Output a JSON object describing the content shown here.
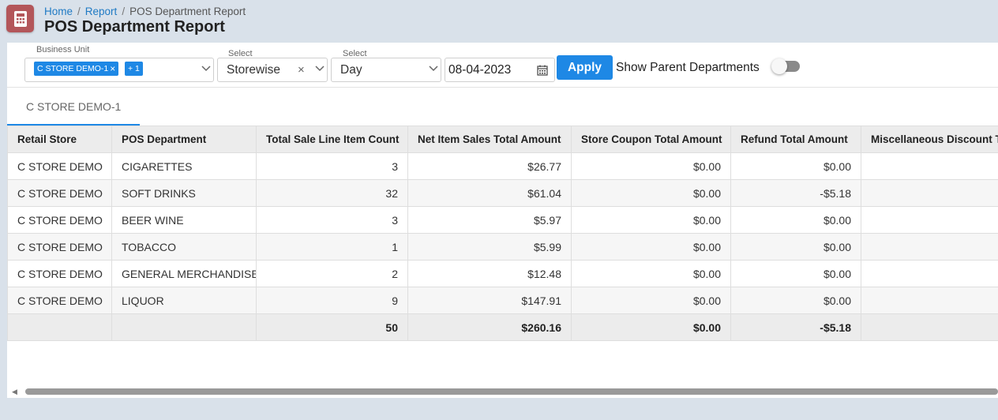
{
  "breadcrumb": {
    "home": "Home",
    "report": "Report",
    "current": "POS Department Report"
  },
  "page": {
    "title": "POS Department Report"
  },
  "filters": {
    "business_unit": {
      "label": "Business Unit",
      "chip": "C STORE DEMO-1",
      "more_chip": "+ 1"
    },
    "grouping": {
      "label": "Select",
      "value": "Storewise"
    },
    "period": {
      "label": "Select",
      "value": "Day"
    },
    "date": {
      "value": "08-04-2023"
    },
    "apply_label": "Apply",
    "show_parent_label": "Show Parent Departments",
    "show_parent_enabled": false
  },
  "tabs": [
    {
      "label": "C STORE DEMO-1",
      "active": true
    }
  ],
  "table": {
    "columns": [
      "Retail Store",
      "POS Department",
      "Total Sale Line Item Count",
      "Net Item Sales Total Amount",
      "Store Coupon Total Amount",
      "Refund Total Amount",
      "Miscellaneous Discount Total Amount"
    ],
    "rows": [
      [
        "C STORE DEMO",
        "CIGARETTES",
        "3",
        "$26.77",
        "$0.00",
        "$0.00",
        ""
      ],
      [
        "C STORE DEMO",
        "SOFT DRINKS",
        "32",
        "$61.04",
        "$0.00",
        "-$5.18",
        ""
      ],
      [
        "C STORE DEMO",
        "BEER WINE",
        "3",
        "$5.97",
        "$0.00",
        "$0.00",
        ""
      ],
      [
        "C STORE DEMO",
        "TOBACCO",
        "1",
        "$5.99",
        "$0.00",
        "$0.00",
        ""
      ],
      [
        "C STORE DEMO",
        "GENERAL MERCHANDISE",
        "2",
        "$12.48",
        "$0.00",
        "$0.00",
        ""
      ],
      [
        "C STORE DEMO",
        "LIQUOR",
        "9",
        "$147.91",
        "$0.00",
        "$0.00",
        ""
      ]
    ],
    "totals": [
      "",
      "",
      "50",
      "$260.16",
      "$0.00",
      "-$5.18",
      ""
    ]
  },
  "colors": {
    "accent": "#1e88e5",
    "app_icon": "#b3565a",
    "background": "#d9e1ea"
  }
}
